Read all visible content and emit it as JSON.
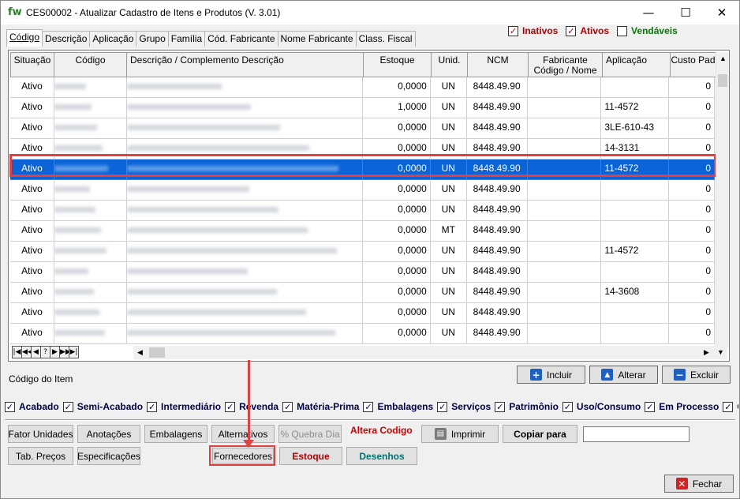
{
  "window": {
    "logo": "fw",
    "title": "CES00002 - Atualizar Cadastro de Itens e Produtos  (V. 3.01)",
    "minimize": "—",
    "maximize": "☐",
    "close": "✕"
  },
  "tabs": [
    "Código",
    "Descrição",
    "Aplicação",
    "Grupo",
    "Família",
    "Cód. Fabricante",
    "Nome Fabricante",
    "Class. Fiscal"
  ],
  "filters": {
    "inativos": {
      "label": "Inativos",
      "checked": "✓"
    },
    "ativos": {
      "label": "Ativos",
      "checked": "✓"
    },
    "vendaveis": {
      "label": "Vendáveis",
      "checked": ""
    }
  },
  "grid": {
    "columns": [
      "Situação",
      "Código",
      "Descrição / Complemento Descrição",
      "Estoque",
      "Unid.",
      "NCM",
      "Fabricante\nCódigo / Nome",
      "Aplicação",
      "Custo Pad"
    ],
    "rows": [
      {
        "situacao": "Ativo",
        "estoque": "0,0000",
        "unid": "UN",
        "ncm": "8448.49.90",
        "aplicacao": "",
        "custo": "0"
      },
      {
        "situacao": "Ativo",
        "estoque": "1,0000",
        "unid": "UN",
        "ncm": "8448.49.90",
        "aplicacao": "11-4572",
        "custo": "0"
      },
      {
        "situacao": "Ativo",
        "estoque": "0,0000",
        "unid": "UN",
        "ncm": "8448.49.90",
        "aplicacao": "3LE-610-43",
        "custo": "0"
      },
      {
        "situacao": "Ativo",
        "estoque": "0,0000",
        "unid": "UN",
        "ncm": "8448.49.90",
        "aplicacao": "14-3131",
        "custo": "0"
      },
      {
        "situacao": "Ativo",
        "estoque": "0,0000",
        "unid": "UN",
        "ncm": "8448.49.90",
        "aplicacao": "11-4572",
        "custo": "0"
      },
      {
        "situacao": "Ativo",
        "estoque": "0,0000",
        "unid": "UN",
        "ncm": "8448.49.90",
        "aplicacao": "",
        "custo": "0"
      },
      {
        "situacao": "Ativo",
        "estoque": "0,0000",
        "unid": "UN",
        "ncm": "8448.49.90",
        "aplicacao": "",
        "custo": "0"
      },
      {
        "situacao": "Ativo",
        "estoque": "0,0000",
        "unid": "MT",
        "ncm": "8448.49.90",
        "aplicacao": "",
        "custo": "0"
      },
      {
        "situacao": "Ativo",
        "estoque": "0,0000",
        "unid": "UN",
        "ncm": "8448.49.90",
        "aplicacao": "11-4572",
        "custo": "0"
      },
      {
        "situacao": "Ativo",
        "estoque": "0,0000",
        "unid": "UN",
        "ncm": "8448.49.90",
        "aplicacao": "",
        "custo": "0"
      },
      {
        "situacao": "Ativo",
        "estoque": "0,0000",
        "unid": "UN",
        "ncm": "8448.49.90",
        "aplicacao": "14-3608",
        "custo": "0"
      },
      {
        "situacao": "Ativo",
        "estoque": "0,0000",
        "unid": "UN",
        "ncm": "8448.49.90",
        "aplicacao": "",
        "custo": "0"
      },
      {
        "situacao": "Ativo",
        "estoque": "0,0000",
        "unid": "UN",
        "ncm": "8448.49.90",
        "aplicacao": "",
        "custo": "0"
      }
    ],
    "selected_row": 4,
    "nav": [
      "|◀",
      "◀◀",
      "◀",
      "?",
      "▶",
      "▶▶",
      "▶|"
    ]
  },
  "code_label": "Código do Item",
  "actions": {
    "incluir": "Incluir",
    "alterar": "Alterar",
    "excluir": "Excluir"
  },
  "types": [
    {
      "label": "Acabado",
      "checked": "✓"
    },
    {
      "label": "Semi-Acabado",
      "checked": "✓"
    },
    {
      "label": "Intermediário",
      "checked": "✓"
    },
    {
      "label": "Revenda",
      "checked": "✓"
    },
    {
      "label": "Matéria-Prima",
      "checked": "✓"
    },
    {
      "label": "Embalagens",
      "checked": "✓"
    },
    {
      "label": "Serviços",
      "checked": "✓"
    },
    {
      "label": "Patrimônio",
      "checked": "✓"
    },
    {
      "label": "Uso/Consumo",
      "checked": "✓"
    },
    {
      "label": "Em Processo",
      "checked": "✓"
    },
    {
      "label": "Outros",
      "checked": "✓"
    }
  ],
  "bottom_buttons": {
    "fator_unidades": "Fator Unidades",
    "anotacoes": "Anotações",
    "embalagens": "Embalagens",
    "alternativos": "Alternativos",
    "quebra_dia": "% Quebra Dia",
    "altera_codigo": "Altera Codigo",
    "imprimir": "Imprimir",
    "copiar_para": "Copiar para",
    "tab_precos": "Tab. Preços",
    "especificacoes": "Especificações",
    "fornecedores": "Fornecedores",
    "estoque": "Estoque",
    "desenhos": "Desenhos",
    "fechar": "Fechar"
  },
  "copy_target_value": ""
}
